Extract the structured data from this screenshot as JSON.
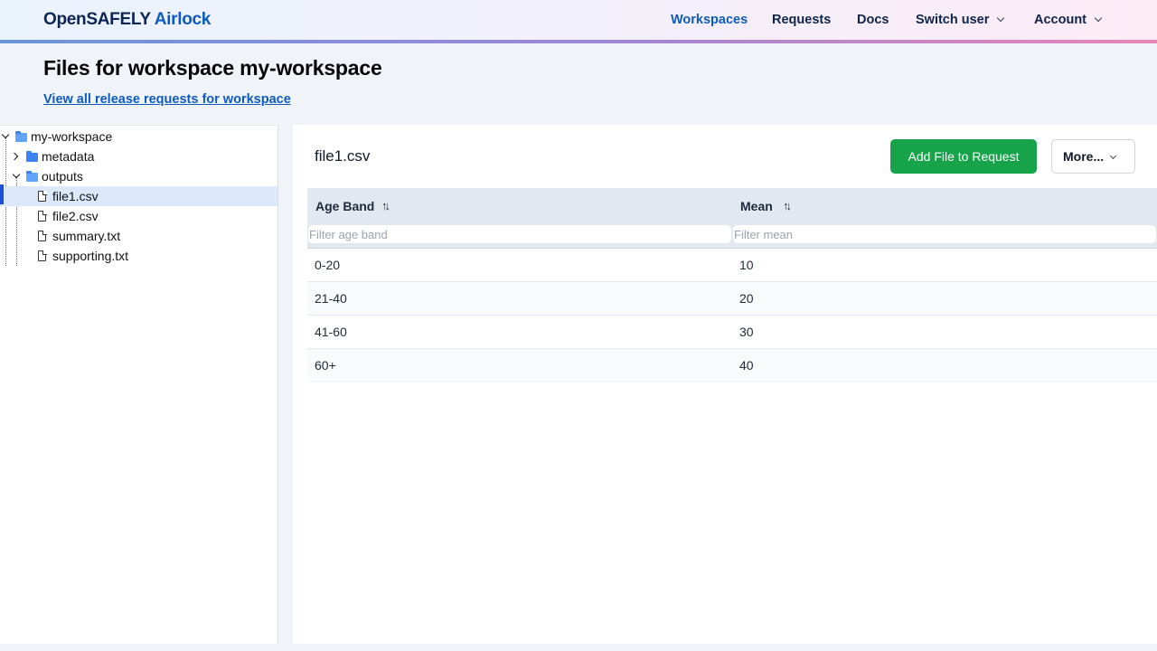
{
  "header": {
    "brand_primary": "OpenSAFELY",
    "brand_secondary": "Airlock",
    "nav": [
      {
        "label": "Workspaces",
        "active": true
      },
      {
        "label": "Requests"
      },
      {
        "label": "Docs"
      },
      {
        "label": "Switch user",
        "dropdown": true
      },
      {
        "label": "Account",
        "dropdown": true
      }
    ]
  },
  "page": {
    "title": "Files for workspace my-workspace",
    "link": "View all release requests for workspace"
  },
  "tree": {
    "items": [
      {
        "label": "my-workspace",
        "type": "folder",
        "expanded": true
      },
      {
        "label": "metadata",
        "type": "folder",
        "expanded": false
      },
      {
        "label": "outputs",
        "type": "folder",
        "expanded": true
      },
      {
        "label": "file1.csv",
        "type": "file",
        "selected": true
      },
      {
        "label": "file2.csv",
        "type": "file"
      },
      {
        "label": "summary.txt",
        "type": "file"
      },
      {
        "label": "supporting.txt",
        "type": "file"
      }
    ]
  },
  "content": {
    "file_title": "file1.csv",
    "add_button": "Add File to Request",
    "more_button": "More...",
    "table": {
      "columns": [
        {
          "label": "Age Band",
          "filter_placeholder": "Filter age band",
          "filter_value": ""
        },
        {
          "label": "Mean",
          "filter_placeholder": "Filter mean",
          "filter_value": ""
        }
      ],
      "rows": [
        [
          "0-20",
          "10"
        ],
        [
          "21-40",
          "20"
        ],
        [
          "41-60",
          "30"
        ],
        [
          "60+",
          "40"
        ]
      ]
    }
  },
  "colors": {
    "accent": "#0d5bbf",
    "primary_button": "#16a34a",
    "selection": "#dce9fb"
  }
}
